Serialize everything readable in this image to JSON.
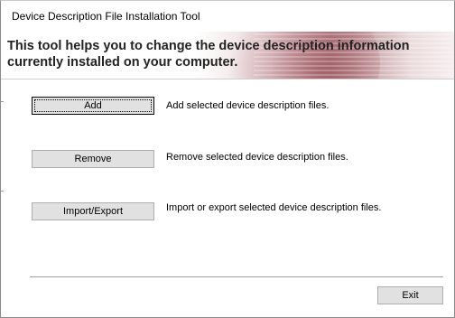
{
  "window": {
    "title": "Device Description File Installation Tool"
  },
  "banner": {
    "text": "This tool helps you to change the device description information currently installed on your computer."
  },
  "actions": [
    {
      "label": "Add",
      "description": "Add selected device description files."
    },
    {
      "label": "Remove",
      "description": "Remove selected device description files."
    },
    {
      "label": "Import/Export",
      "description": "Import or export selected device description files."
    }
  ],
  "footer": {
    "exit_label": "Exit"
  }
}
